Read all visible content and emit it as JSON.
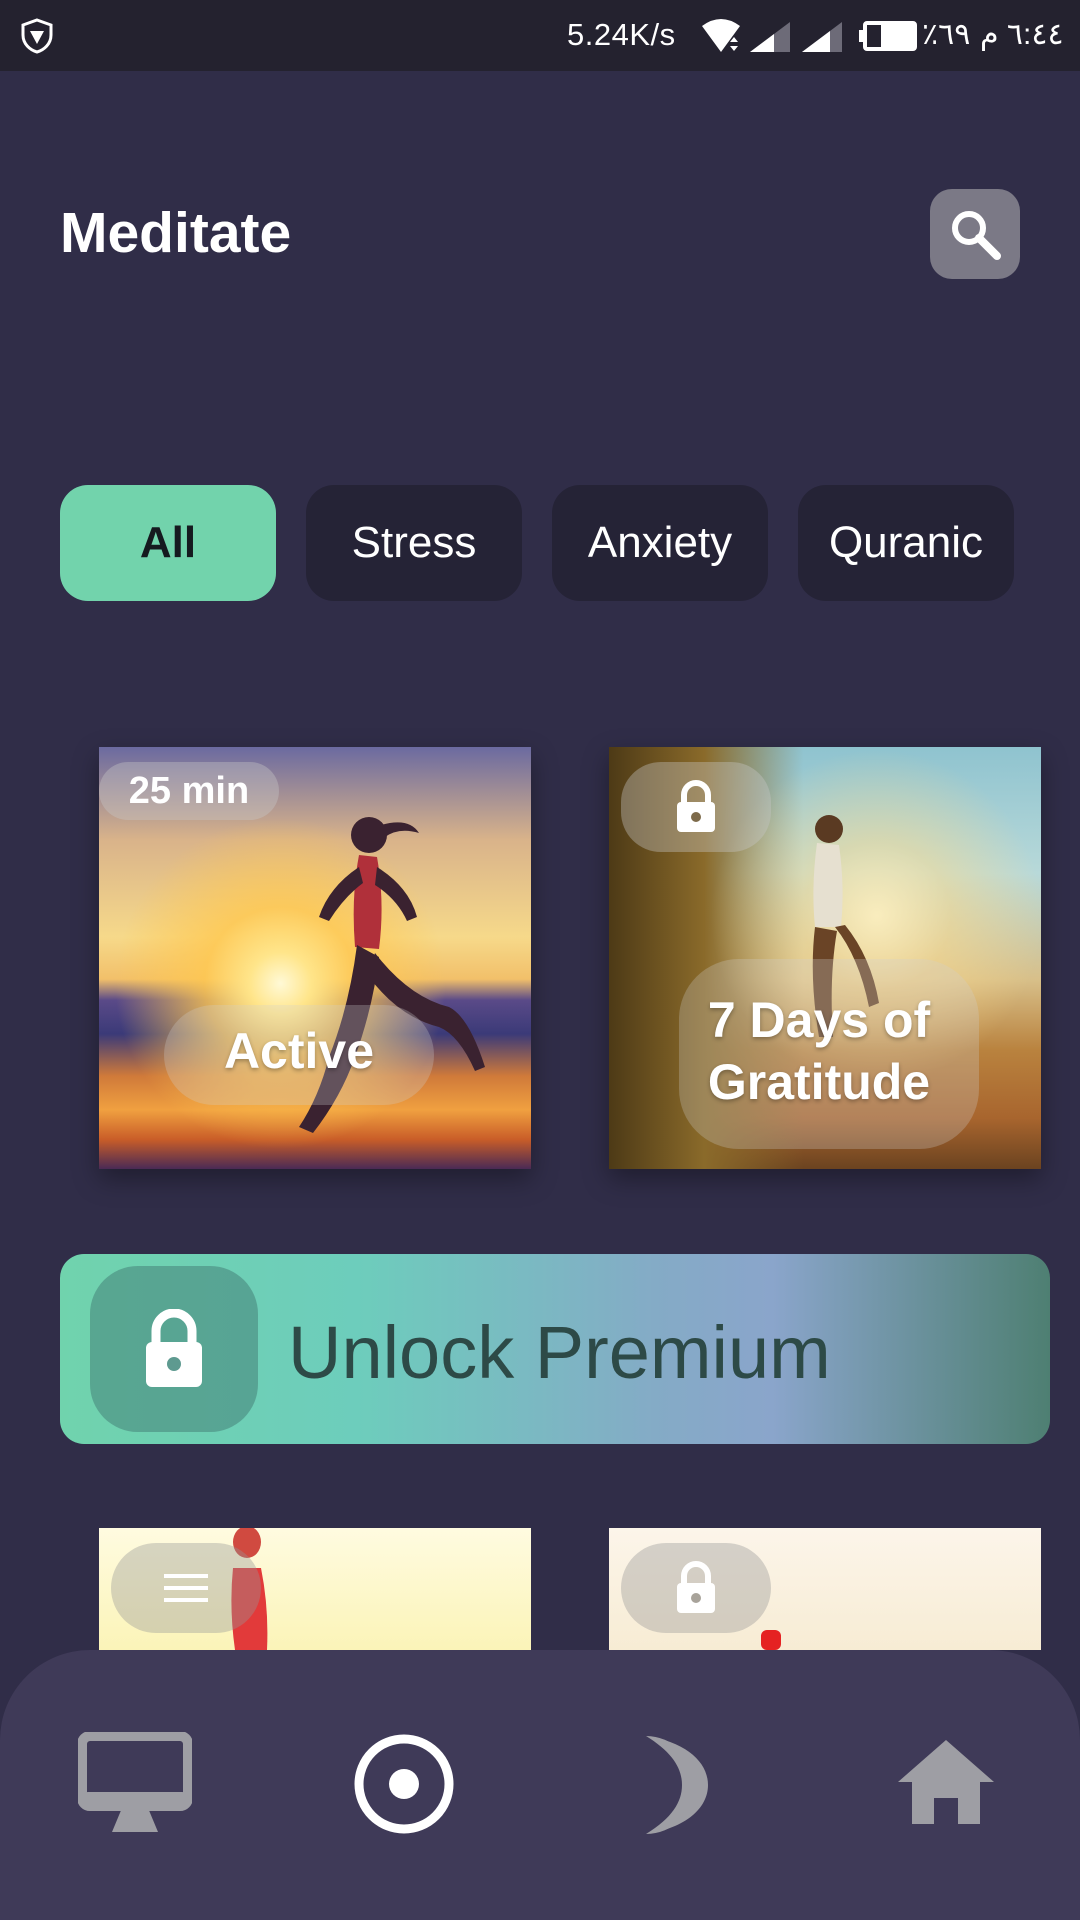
{
  "status_bar": {
    "speed": "5.24K/s",
    "battery": "٪٦٩",
    "time": "٦:٤٤ م",
    "icons": [
      "shield-icon",
      "wifi-icon",
      "signal-icon",
      "signal-icon",
      "battery-icon"
    ]
  },
  "header": {
    "title": "Meditate",
    "search_icon": "search-icon"
  },
  "filters": {
    "selected": "All",
    "items": [
      {
        "label": "All"
      },
      {
        "label": "Stress"
      },
      {
        "label": "Anxiety"
      },
      {
        "label": "Quranic"
      }
    ]
  },
  "cards": [
    {
      "title": "Active",
      "duration": "25 min",
      "locked": false
    },
    {
      "title_line1": "7 Days of",
      "title_line2": "Gratitude",
      "locked": true,
      "lock_icon": "lock-icon"
    }
  ],
  "premium": {
    "label": "Unlock Premium",
    "icon": "lock-icon"
  },
  "partial_cards": [
    {
      "icon": "menu-icon"
    },
    {
      "icon": "lock-icon"
    }
  ],
  "bottom_nav": {
    "items": [
      {
        "icon": "monitor-icon"
      },
      {
        "icon": "meditate-circle-icon",
        "active": true
      },
      {
        "icon": "moon-icon"
      },
      {
        "icon": "home-icon"
      }
    ]
  },
  "colors": {
    "background": "#302d48",
    "accent": "#72d3ac",
    "chip": "#252336",
    "nav": "#3f3a58"
  }
}
